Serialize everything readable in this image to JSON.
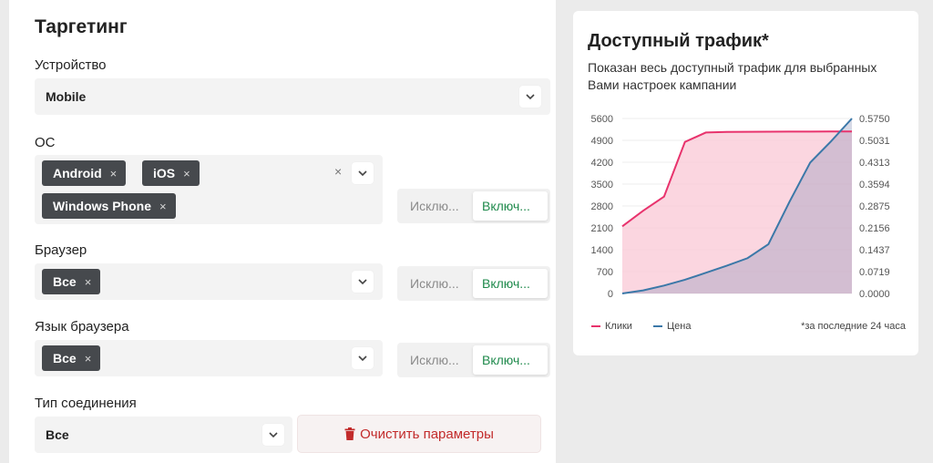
{
  "targeting": {
    "title": "Таргетинг",
    "device": {
      "label": "Устройство",
      "value": "Mobile"
    },
    "os": {
      "label": "ОС",
      "tags": [
        "Android",
        "iOS",
        "Windows Phone"
      ],
      "clear_glyph": "×"
    },
    "browser": {
      "label": "Браузер",
      "tags": [
        "Все"
      ]
    },
    "browser_lang": {
      "label": "Язык браузера",
      "tags": [
        "Все"
      ]
    },
    "connection": {
      "label": "Тип соединения",
      "value": "Все"
    },
    "toggle": {
      "exclude": "Исклю...",
      "include": "Включ..."
    },
    "tag_remove_glyph": "×",
    "clear_button": "Очистить параметры"
  },
  "traffic": {
    "title": "Доступный трафик*",
    "subtitle": "Показан весь доступный трафик для выбранных Вами настроек кампании",
    "legend": {
      "clicks": "Клики",
      "price": "Цена"
    },
    "note": "*за последние 24 часа"
  },
  "colors": {
    "clicks": "#e8336d",
    "price": "#3b78a8",
    "clear": "#c22b2b",
    "include": "#1f8a4c"
  },
  "icons": {
    "chevron": "chevron-down-icon",
    "trash": "trash-icon",
    "remove": "close-icon"
  },
  "chart_data": {
    "type": "area",
    "x": [
      0,
      1,
      2,
      3,
      4,
      5,
      6,
      7,
      8,
      9,
      10,
      11
    ],
    "series": [
      {
        "name": "Клики",
        "axis": "left",
        "values": [
          2150,
          2650,
          3100,
          4850,
          5150,
          5170,
          5175,
          5178,
          5180,
          5182,
          5184,
          5185
        ]
      },
      {
        "name": "Цена",
        "axis": "right",
        "values": [
          0.0,
          0.01,
          0.026,
          0.045,
          0.068,
          0.091,
          0.116,
          0.162,
          0.3,
          0.43,
          0.5,
          0.575
        ]
      }
    ],
    "left_ticks": [
      "5600",
      "4900",
      "4200",
      "3500",
      "2800",
      "2100",
      "1400",
      "700",
      "0"
    ],
    "right_ticks": [
      "0.5750",
      "0.5031",
      "0.4313",
      "0.3594",
      "0.2875",
      "0.2156",
      "0.1437",
      "0.0719",
      "0.0000"
    ],
    "ylim_left": [
      0,
      5600
    ],
    "ylim_right": [
      0,
      0.575
    ],
    "grid": true,
    "legend_position": "bottom"
  }
}
